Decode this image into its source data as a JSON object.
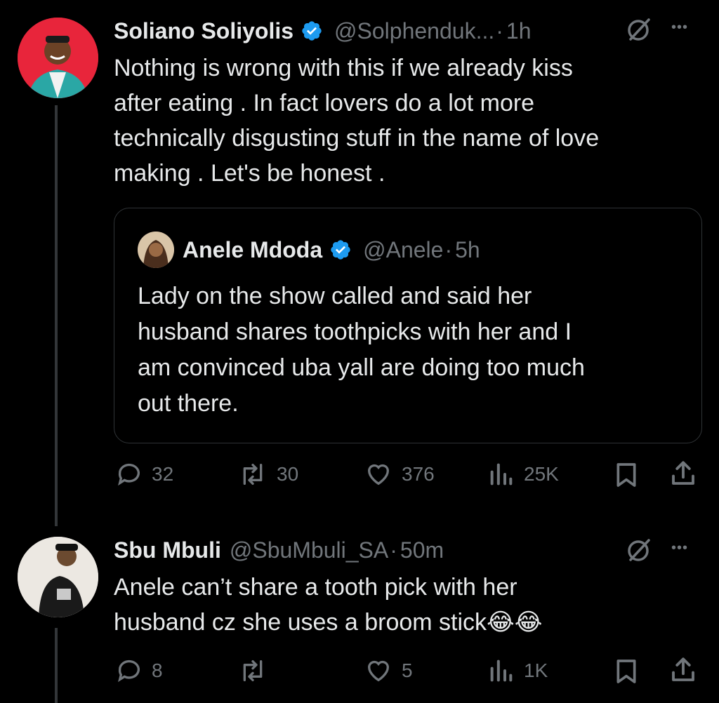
{
  "tweet1": {
    "name": "Soliano Soliyolis",
    "handle": "@Solphenduk...",
    "time": "1h",
    "sep": "·",
    "text_lines": [
      "Nothing is wrong with this if we already kiss",
      "after eating . In fact lovers do a lot more",
      "technically disgusting stuff in the name of love",
      "making . Let's be honest ."
    ],
    "quote": {
      "name": "Anele Mdoda",
      "handle": "@Anele",
      "time": "5h",
      "text_lines": [
        "Lady on the show called and said her",
        "husband shares toothpicks with her and I",
        "am convinced uba yall are doing too much",
        "out there."
      ]
    },
    "actions": {
      "replies": "32",
      "reposts": "30",
      "likes": "376",
      "views": "25K"
    }
  },
  "tweet2": {
    "name": "Sbu Mbuli",
    "handle": "@SbuMbuli_SA",
    "time": "50m",
    "sep": "·",
    "text_lines": [
      "Anele can’t share a tooth pick with her",
      "husband cz she uses a broom stick😂😂"
    ],
    "actions": {
      "replies": "8",
      "likes": "5",
      "views": "1K"
    }
  },
  "more_glyph": "•••",
  "colors": {
    "verified": "#1d9bf0",
    "muted": "#71767b",
    "text": "#e7e9ea",
    "bg": "#000000",
    "border": "#2f3336"
  },
  "icons": [
    "verified-badge-icon",
    "grok-icon",
    "more-icon",
    "reply-icon",
    "repost-icon",
    "like-icon",
    "views-icon",
    "bookmark-icon",
    "share-icon"
  ]
}
